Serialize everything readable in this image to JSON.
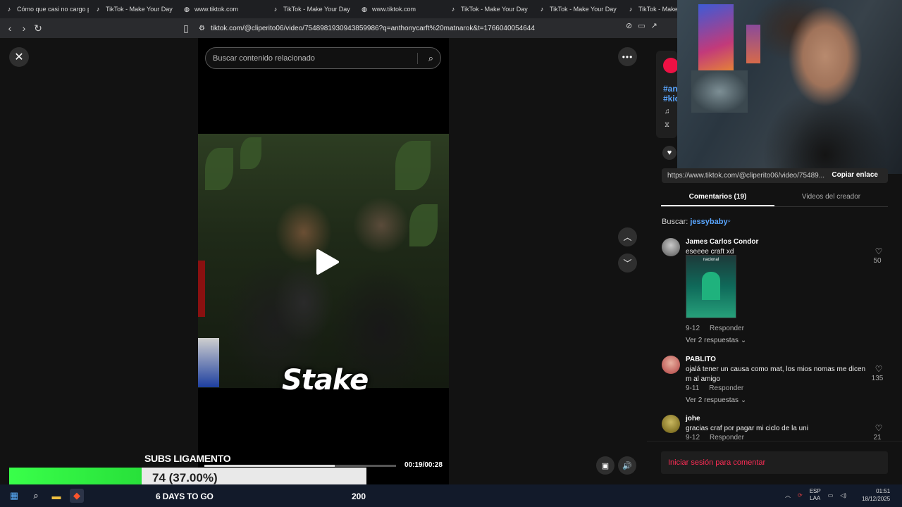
{
  "browser": {
    "tabs": [
      {
        "label": "Cómo que casi no cargo p",
        "icon": "tiktok-icon"
      },
      {
        "label": "TikTok - Make Your Day",
        "icon": "tiktok-icon"
      },
      {
        "label": "www.tiktok.com",
        "icon": "globe-icon"
      },
      {
        "label": "TikTok - Make Your Day",
        "icon": "tiktok-icon"
      },
      {
        "label": "www.tiktok.com",
        "icon": "globe-icon"
      },
      {
        "label": "TikTok - Make Your Day",
        "icon": "tiktok-icon"
      },
      {
        "label": "TikTok - Make Your Day",
        "icon": "tiktok-icon"
      },
      {
        "label": "TikTok - Make",
        "icon": "tiktok-icon"
      }
    ],
    "url": "tiktok.com/@cliperito06/video/7548981930943859986?q=anthonycarft%20matnarok&t=1766040054644"
  },
  "player": {
    "search_placeholder": "Buscar contenido relacionado",
    "brand_overlay": "Stake",
    "time": "00:19/00:28",
    "progress": 0.68
  },
  "side": {
    "hashtags": [
      "#an",
      "#kic"
    ],
    "link": "https://www.tiktok.com/@cliperito06/video/75489...",
    "copy_label": "Copiar enlace",
    "tabs": [
      {
        "label": "Comentarios (19)",
        "active": true
      },
      {
        "label": "Videos del creador",
        "active": false
      }
    ],
    "search_label": "Buscar:",
    "search_query": "jessybaby",
    "comments": [
      {
        "name": "James Carlos Condor",
        "text": "eseeee craft xd",
        "date": "9-12",
        "reply": "Responder",
        "more": "Ver 2 respuestas",
        "likes": "50",
        "has_image": true,
        "image_text": "nacional"
      },
      {
        "name": "PABLITO",
        "text": "ojalá tener un causa como mat, los mios nomas me dicen m al amigo",
        "date": "9-11",
        "reply": "Responder",
        "more": "Ver 2 respuestas",
        "likes": "135"
      },
      {
        "name": "johe",
        "text": "gracias craf por pagar mi ciclo de la uni",
        "date": "9-12",
        "reply": "Responder",
        "likes": "21"
      }
    ],
    "login_label": "Iniciar sesión para comentar"
  },
  "stream_overlay": {
    "title": "SUBS LIGAMENTO",
    "goal_text": "74 (37.00%)",
    "goal_progress": 0.37,
    "days": "6 DAYS TO GO",
    "target": "200"
  },
  "taskbar": {
    "lang1": "ESP",
    "lang2": "LAA",
    "time": "01:51",
    "date": "18/12/2025"
  }
}
